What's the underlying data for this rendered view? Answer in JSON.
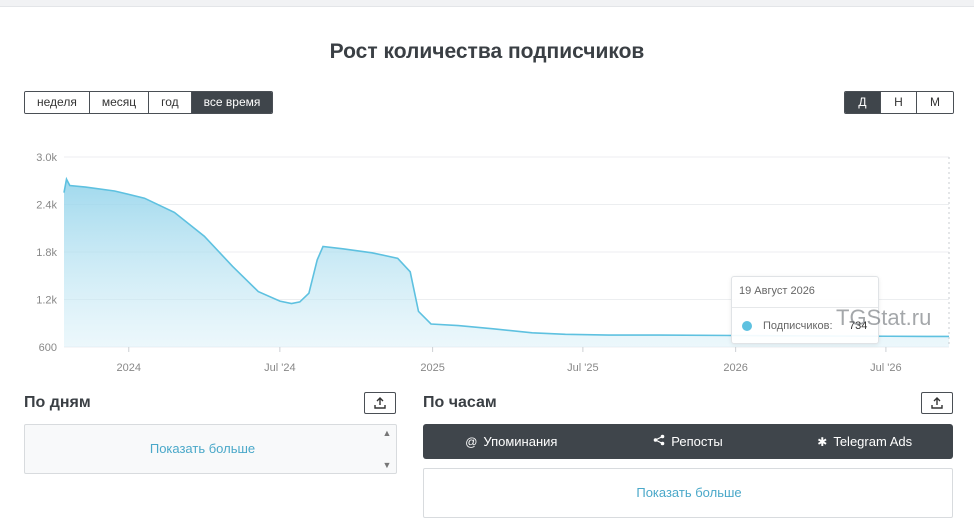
{
  "title": "Рост количества подписчиков",
  "range_buttons": [
    {
      "label": "неделя",
      "active": false
    },
    {
      "label": "месяц",
      "active": false
    },
    {
      "label": "год",
      "active": false
    },
    {
      "label": "все время",
      "active": true
    }
  ],
  "granularity_buttons": [
    {
      "label": "Д",
      "active": true
    },
    {
      "label": "Н",
      "active": false
    },
    {
      "label": "М",
      "active": false
    }
  ],
  "chart_data": {
    "type": "area",
    "title": "Рост количества подписчиков",
    "series": [
      {
        "name": "Подписчики",
        "color": "#5ec1e0",
        "points": [
          [
            "2023-10-15",
            2550
          ],
          [
            "2023-10-18",
            2720
          ],
          [
            "2023-10-22",
            2640
          ],
          [
            "2023-11-10",
            2620
          ],
          [
            "2023-12-15",
            2570
          ],
          [
            "2024-01-20",
            2480
          ],
          [
            "2024-02-25",
            2300
          ],
          [
            "2024-04-01",
            2000
          ],
          [
            "2024-05-05",
            1620
          ],
          [
            "2024-06-05",
            1300
          ],
          [
            "2024-07-01",
            1180
          ],
          [
            "2024-07-15",
            1150
          ],
          [
            "2024-07-25",
            1170
          ],
          [
            "2024-08-05",
            1280
          ],
          [
            "2024-08-15",
            1700
          ],
          [
            "2024-08-22",
            1870
          ],
          [
            "2024-09-15",
            1840
          ],
          [
            "2024-10-20",
            1790
          ],
          [
            "2024-11-20",
            1720
          ],
          [
            "2024-12-05",
            1550
          ],
          [
            "2024-12-15",
            1050
          ],
          [
            "2024-12-30",
            890
          ],
          [
            "2025-02-01",
            870
          ],
          [
            "2025-03-15",
            830
          ],
          [
            "2025-05-01",
            780
          ],
          [
            "2025-06-10",
            760
          ],
          [
            "2025-08-01",
            750
          ],
          [
            "2025-10-01",
            750
          ],
          [
            "2026-01-01",
            745
          ],
          [
            "2026-04-01",
            740
          ],
          [
            "2026-08-19",
            734
          ],
          [
            "2026-09-15",
            734
          ]
        ]
      }
    ],
    "y_ticks": [
      "600",
      "1.2k",
      "1.8k",
      "2.4k",
      "3.0k"
    ],
    "x_ticks": [
      "2024",
      "Jul '24",
      "2025",
      "Jul '25",
      "2026",
      "Jul '26"
    ],
    "ylim": [
      600,
      3000
    ]
  },
  "tooltip": {
    "date": "19 Август 2026",
    "label": "Подписчиков:",
    "value": "734"
  },
  "watermark": "TGStat.ru",
  "by_days": {
    "title": "По дням",
    "more": "Показать больше"
  },
  "by_hours": {
    "title": "По часам",
    "more": "Показать больше",
    "tabs": [
      {
        "icon": "@",
        "label": "Упоминания"
      },
      {
        "icon": "share",
        "label": "Репосты"
      },
      {
        "icon": "✱",
        "label": "Telegram Ads"
      }
    ]
  }
}
